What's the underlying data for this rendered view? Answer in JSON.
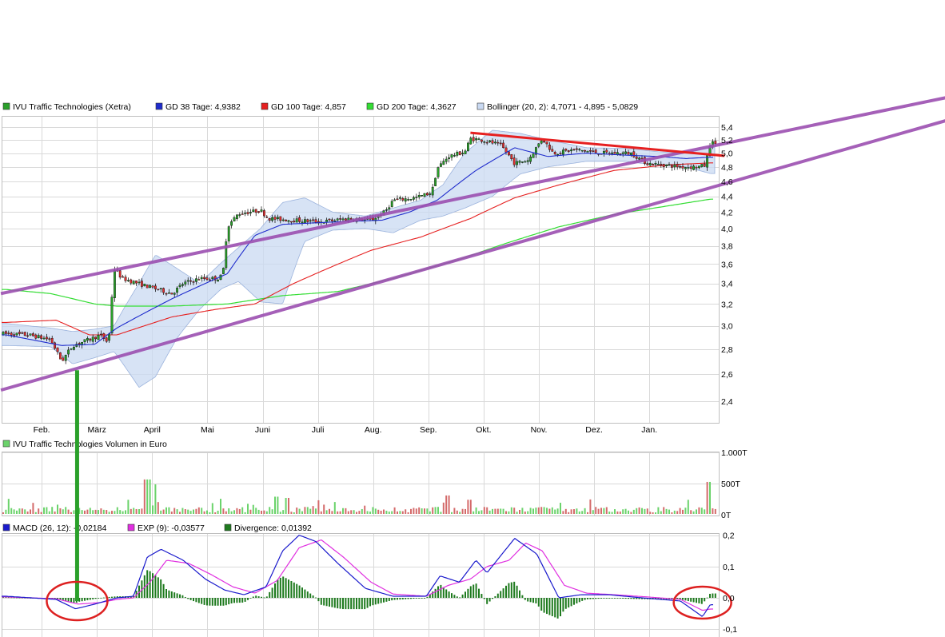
{
  "colors": {
    "price": "#2aa02a",
    "gd38": "#1f2ccc",
    "gd100": "#e62020",
    "gd200": "#33dd33",
    "bollinger_fill": "#c9d9f2",
    "bollinger_line": "#9bb3dd",
    "channel": "#9b4fb0",
    "resistance": "#e62020",
    "macd": "#1a1acc",
    "signal": "#e030e0",
    "divergence": "#1e7a1e",
    "volume_up": "#6bd36b",
    "volume_down": "#d46a6a",
    "annotation_green": "#2aa02a",
    "annotation_red": "#dd2020"
  },
  "chart_data": [
    {
      "type": "line",
      "name": "price",
      "legend": [
        {
          "label": "IVU Traffic Technologies (Xetra)",
          "color": "#2aa02a"
        },
        {
          "label": "GD 38 Tage: 4,9382",
          "color": "#1f2ccc"
        },
        {
          "label": "GD 100 Tage: 4,857",
          "color": "#e62020"
        },
        {
          "label": "GD 200 Tage: 4,3627",
          "color": "#33dd33"
        },
        {
          "label": "Bollinger (20, 2): 4,7071 - 4,895 - 5,0829",
          "color": "#c9d9f2"
        }
      ],
      "x_labels": [
        "Feb.",
        "März",
        "April",
        "Mai",
        "Juni",
        "Juli",
        "Aug.",
        "Sep.",
        "Okt.",
        "Nov.",
        "Dez.",
        "Jan."
      ],
      "y_ticks": [
        "5,4",
        "5,2",
        "5,0",
        "4,8",
        "4,6",
        "4,4",
        "4,2",
        "4,0",
        "3,8",
        "3,6",
        "3,4",
        "3,2",
        "3,0",
        "2,8",
        "2,6",
        "2,4"
      ],
      "y_tick_values": [
        5.4,
        5.2,
        5.0,
        4.8,
        4.6,
        4.4,
        4.2,
        4.0,
        3.8,
        3.6,
        3.4,
        3.2,
        3.0,
        2.8,
        2.6,
        2.4
      ],
      "x_range": [
        0,
        12.9
      ],
      "scale": "log",
      "grid": true,
      "price_keypoints": [
        [
          0,
          2.93
        ],
        [
          0.4,
          2.92
        ],
        [
          0.8,
          2.88
        ],
        [
          1.0,
          2.7
        ],
        [
          1.2,
          2.83
        ],
        [
          1.5,
          2.88
        ],
        [
          1.7,
          2.92
        ],
        [
          1.85,
          2.85
        ],
        [
          1.95,
          3.55
        ],
        [
          2.1,
          3.45
        ],
        [
          2.5,
          3.38
        ],
        [
          3.0,
          3.3
        ],
        [
          3.2,
          3.4
        ],
        [
          3.5,
          3.45
        ],
        [
          3.85,
          3.45
        ],
        [
          3.92,
          3.5
        ],
        [
          4.0,
          4.02
        ],
        [
          4.2,
          4.18
        ],
        [
          4.6,
          4.22
        ],
        [
          4.75,
          4.12
        ],
        [
          5.2,
          4.1
        ],
        [
          5.7,
          4.08
        ],
        [
          6.2,
          4.12
        ],
        [
          6.6,
          4.1
        ],
        [
          6.85,
          4.2
        ],
        [
          7.0,
          4.35
        ],
        [
          7.4,
          4.38
        ],
        [
          7.7,
          4.45
        ],
        [
          7.8,
          4.78
        ],
        [
          8.0,
          4.95
        ],
        [
          8.3,
          5.02
        ],
        [
          8.4,
          5.22
        ],
        [
          8.6,
          5.2
        ],
        [
          8.95,
          5.12
        ],
        [
          9.2,
          4.85
        ],
        [
          9.45,
          4.9
        ],
        [
          9.7,
          5.22
        ],
        [
          9.9,
          5.0
        ],
        [
          10.3,
          5.05
        ],
        [
          10.8,
          5.0
        ],
        [
          11.3,
          5.0
        ],
        [
          11.6,
          4.85
        ],
        [
          12.0,
          4.82
        ],
        [
          12.25,
          4.8
        ],
        [
          12.5,
          4.8
        ],
        [
          12.65,
          4.82
        ],
        [
          12.74,
          5.15
        ]
      ],
      "gd38_keypoints": [
        [
          0,
          2.92
        ],
        [
          1.0,
          2.83
        ],
        [
          1.6,
          2.84
        ],
        [
          2.0,
          2.98
        ],
        [
          3.0,
          3.25
        ],
        [
          4.0,
          3.5
        ],
        [
          4.5,
          3.92
        ],
        [
          5.0,
          4.05
        ],
        [
          6.0,
          4.08
        ],
        [
          6.8,
          4.1
        ],
        [
          7.3,
          4.2
        ],
        [
          7.8,
          4.35
        ],
        [
          8.5,
          4.75
        ],
        [
          9.2,
          5.08
        ],
        [
          9.8,
          4.95
        ],
        [
          10.5,
          5.0
        ],
        [
          11.2,
          4.97
        ],
        [
          11.8,
          4.95
        ],
        [
          12.3,
          4.92
        ],
        [
          12.74,
          4.94
        ]
      ],
      "gd100_keypoints": [
        [
          0,
          3.03
        ],
        [
          0.9,
          3.05
        ],
        [
          1.5,
          2.92
        ],
        [
          2.0,
          2.92
        ],
        [
          3.0,
          3.08
        ],
        [
          3.8,
          3.15
        ],
        [
          4.5,
          3.2
        ],
        [
          5.2,
          3.4
        ],
        [
          6.0,
          3.6
        ],
        [
          6.6,
          3.75
        ],
        [
          7.5,
          3.9
        ],
        [
          8.4,
          4.12
        ],
        [
          9.2,
          4.38
        ],
        [
          10.0,
          4.55
        ],
        [
          11.0,
          4.75
        ],
        [
          12.0,
          4.83
        ],
        [
          12.74,
          4.857
        ]
      ],
      "gd200_keypoints": [
        [
          0,
          3.34
        ],
        [
          0.8,
          3.3
        ],
        [
          1.6,
          3.2
        ],
        [
          2.0,
          3.18
        ],
        [
          3.0,
          3.18
        ],
        [
          4.0,
          3.2
        ],
        [
          5.0,
          3.28
        ],
        [
          6.0,
          3.32
        ],
        [
          7.0,
          3.45
        ],
        [
          8.2,
          3.65
        ],
        [
          9.0,
          3.82
        ],
        [
          10.0,
          4.02
        ],
        [
          11.0,
          4.17
        ],
        [
          12.0,
          4.28
        ],
        [
          12.74,
          4.3627
        ]
      ],
      "bollinger_keypoints": [
        [
          0,
          3.02,
          2.83
        ],
        [
          0.8,
          2.98,
          2.82
        ],
        [
          1.2,
          2.95,
          2.68
        ],
        [
          1.6,
          2.97,
          2.73
        ],
        [
          1.95,
          3.0,
          2.78
        ],
        [
          2.4,
          3.4,
          2.5
        ],
        [
          2.7,
          3.7,
          2.58
        ],
        [
          3.1,
          3.55,
          2.9
        ],
        [
          3.5,
          3.4,
          3.15
        ],
        [
          3.9,
          3.62,
          3.35
        ],
        [
          4.2,
          3.78,
          3.42
        ],
        [
          4.6,
          4.0,
          3.22
        ],
        [
          5.0,
          4.32,
          3.2
        ],
        [
          5.4,
          4.38,
          3.85
        ],
        [
          5.9,
          4.2,
          3.98
        ],
        [
          6.5,
          4.15,
          4.0
        ],
        [
          7.0,
          4.25,
          3.95
        ],
        [
          7.5,
          4.35,
          4.1
        ],
        [
          7.9,
          4.55,
          4.15
        ],
        [
          8.3,
          5.0,
          4.25
        ],
        [
          8.8,
          5.35,
          4.4
        ],
        [
          9.3,
          5.3,
          4.7
        ],
        [
          9.8,
          5.2,
          4.8
        ],
        [
          10.5,
          5.08,
          4.88
        ],
        [
          11.2,
          5.07,
          4.88
        ],
        [
          11.8,
          5.02,
          4.82
        ],
        [
          12.3,
          5.0,
          4.8
        ],
        [
          12.74,
          5.0829,
          4.7071
        ]
      ],
      "channel_upper": [
        [
          -0.1,
          3.3
        ],
        [
          17.3,
          5.95
        ]
      ],
      "channel_lower": [
        [
          -0.1,
          2.48
        ],
        [
          17.3,
          5.58
        ]
      ],
      "resistance": [
        [
          8.4,
          5.31
        ],
        [
          13.0,
          4.96
        ]
      ],
      "support_note": ""
    },
    {
      "type": "bar",
      "name": "volume",
      "legend": [
        {
          "label": "IVU Traffic Technologies Volumen in Euro",
          "color": "#6bd36b"
        }
      ],
      "y_ticks": [
        "1.000T",
        "500T",
        "0T"
      ],
      "y_tick_values": [
        1000,
        500,
        0
      ],
      "ylim": [
        0,
        1000
      ],
      "volume_spikes": [
        [
          2.55,
          560
        ],
        [
          2.65,
          480
        ],
        [
          4.9,
          280
        ],
        [
          5.1,
          260
        ],
        [
          8.0,
          300
        ],
        [
          8.4,
          230
        ],
        [
          12.72,
          520
        ]
      ]
    },
    {
      "type": "line",
      "name": "macd",
      "legend": [
        {
          "label": "MACD (26, 12): -0,02184",
          "color": "#1a1acc"
        },
        {
          "label": "EXP (9): -0,03577",
          "color": "#e030e0"
        },
        {
          "label": "Divergence: 0,01392",
          "color": "#1e7a1e"
        }
      ],
      "y_ticks": [
        "0,2",
        "0,1",
        "0,0",
        "-0,1"
      ],
      "y_tick_values": [
        0.2,
        0.1,
        0.0,
        -0.1
      ],
      "ylim": [
        -0.1,
        0.2
      ],
      "macd_keypoints": [
        [
          0,
          0.005
        ],
        [
          0.9,
          -0.005
        ],
        [
          1.25,
          -0.035
        ],
        [
          1.6,
          -0.02
        ],
        [
          2.0,
          0.0
        ],
        [
          2.3,
          0.005
        ],
        [
          2.55,
          0.13
        ],
        [
          2.8,
          0.155
        ],
        [
          3.2,
          0.12
        ],
        [
          3.6,
          0.06
        ],
        [
          3.95,
          0.025
        ],
        [
          4.3,
          0.01
        ],
        [
          4.7,
          0.035
        ],
        [
          5.0,
          0.15
        ],
        [
          5.3,
          0.2
        ],
        [
          5.6,
          0.18
        ],
        [
          6.0,
          0.11
        ],
        [
          6.5,
          0.03
        ],
        [
          7.0,
          0.005
        ],
        [
          7.6,
          0.005
        ],
        [
          7.85,
          0.07
        ],
        [
          8.2,
          0.05
        ],
        [
          8.5,
          0.12
        ],
        [
          8.7,
          0.08
        ],
        [
          9.2,
          0.19
        ],
        [
          9.6,
          0.14
        ],
        [
          10.0,
          0.0
        ],
        [
          10.4,
          0.01
        ],
        [
          10.9,
          0.01
        ],
        [
          11.5,
          0.0
        ],
        [
          12.2,
          -0.01
        ],
        [
          12.6,
          -0.06
        ],
        [
          12.74,
          -0.02184
        ]
      ],
      "signal_keypoints": [
        [
          0,
          0.003
        ],
        [
          0.9,
          -0.003
        ],
        [
          1.3,
          -0.02
        ],
        [
          1.7,
          -0.015
        ],
        [
          2.0,
          -0.005
        ],
        [
          2.3,
          0.0
        ],
        [
          2.6,
          0.05
        ],
        [
          2.9,
          0.12
        ],
        [
          3.3,
          0.11
        ],
        [
          3.7,
          0.075
        ],
        [
          4.1,
          0.035
        ],
        [
          4.5,
          0.015
        ],
        [
          4.9,
          0.055
        ],
        [
          5.3,
          0.16
        ],
        [
          5.7,
          0.185
        ],
        [
          6.1,
          0.13
        ],
        [
          6.6,
          0.05
        ],
        [
          7.0,
          0.012
        ],
        [
          7.6,
          0.005
        ],
        [
          8.0,
          0.04
        ],
        [
          8.4,
          0.06
        ],
        [
          8.7,
          0.1
        ],
        [
          9.1,
          0.12
        ],
        [
          9.4,
          0.175
        ],
        [
          9.7,
          0.15
        ],
        [
          10.1,
          0.04
        ],
        [
          10.5,
          0.015
        ],
        [
          11.0,
          0.01
        ],
        [
          11.6,
          0.003
        ],
        [
          12.2,
          -0.005
        ],
        [
          12.6,
          -0.04
        ],
        [
          12.74,
          -0.03577
        ]
      ]
    }
  ]
}
